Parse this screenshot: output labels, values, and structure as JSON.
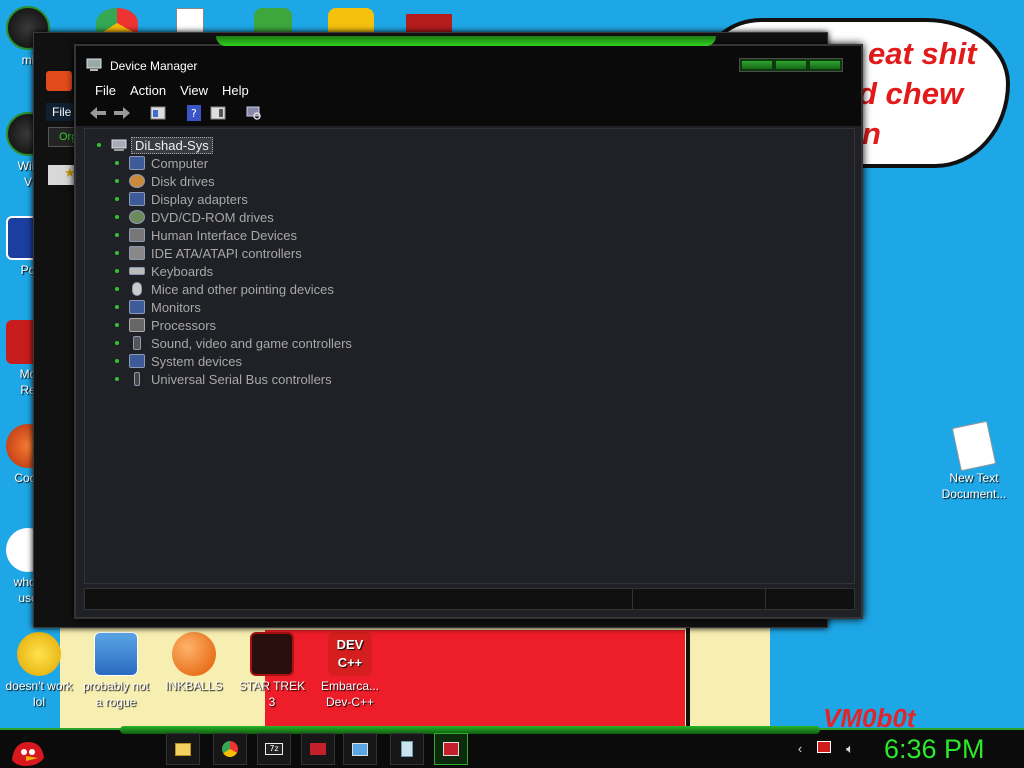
{
  "wallpaper": {
    "bubble_lines": [
      "eat shit",
      "d chew",
      "n"
    ],
    "signature": "VM0b0t"
  },
  "desktop_icons": {
    "left": [
      {
        "label": "mi"
      },
      {
        "label": "Win\nV"
      },
      {
        "label": "Po"
      },
      {
        "label": "Mo\nRe"
      },
      {
        "label": "Cock"
      },
      {
        "label": "who t\nuse"
      }
    ],
    "bottom": [
      {
        "label": "doesn't work\nlol"
      },
      {
        "label": "probably not\na rogue"
      },
      {
        "label": "INKBALLS"
      },
      {
        "label": "STAR TREK\n3"
      },
      {
        "label": "Embarca...\nDev-C++"
      }
    ],
    "right": [
      {
        "label": "New Text\nDocument..."
      }
    ]
  },
  "back_window": {
    "menu_label": "File",
    "organize_label": "Org"
  },
  "device_manager": {
    "title": "Device Manager",
    "menu": [
      "File",
      "Action",
      "View",
      "Help"
    ],
    "root": "DiLshad-Sys",
    "items": [
      {
        "label": "Computer",
        "icon": "computer-icon"
      },
      {
        "label": "Disk drives",
        "icon": "disk-drive-icon"
      },
      {
        "label": "Display adapters",
        "icon": "display-adapter-icon"
      },
      {
        "label": "DVD/CD-ROM drives",
        "icon": "dvd-drive-icon"
      },
      {
        "label": "Human Interface Devices",
        "icon": "hid-icon"
      },
      {
        "label": "IDE ATA/ATAPI controllers",
        "icon": "ide-controller-icon"
      },
      {
        "label": "Keyboards",
        "icon": "keyboard-icon"
      },
      {
        "label": "Mice and other pointing devices",
        "icon": "mouse-icon"
      },
      {
        "label": "Monitors",
        "icon": "monitor-icon"
      },
      {
        "label": "Processors",
        "icon": "processor-icon"
      },
      {
        "label": "Sound, video and game controllers",
        "icon": "sound-icon"
      },
      {
        "label": "System devices",
        "icon": "system-devices-icon"
      },
      {
        "label": "Universal Serial Bus controllers",
        "icon": "usb-icon"
      }
    ]
  },
  "taskbar": {
    "clock": "6:36 PM"
  },
  "colors": {
    "desktop": "#1ea7e6",
    "accent_green": "#2bea2b",
    "window_bg": "#1f2126"
  }
}
